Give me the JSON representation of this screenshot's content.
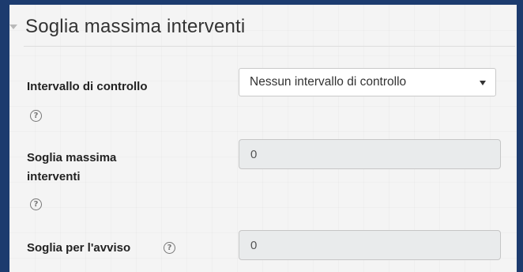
{
  "section": {
    "title": "Soglia massima interventi",
    "collapse_icon": "triangle-down-icon"
  },
  "fields": {
    "interval": {
      "label": "Intervallo di controllo",
      "help_icon": "question-circle-icon",
      "help_glyph": "?",
      "selected": "Nessun intervallo di controllo"
    },
    "max_threshold": {
      "label_line1": "Soglia massima",
      "label_line2": "interventi",
      "help_icon": "question-circle-icon",
      "help_glyph": "?",
      "value": "0"
    },
    "warning_threshold": {
      "label": "Soglia per l'avviso",
      "help_icon": "question-circle-icon",
      "help_glyph": "?",
      "value": "0"
    }
  },
  "colors": {
    "frame": "#1c3b6e",
    "panel": "#f4f4f4",
    "disabled_input": "#e9ebec"
  }
}
